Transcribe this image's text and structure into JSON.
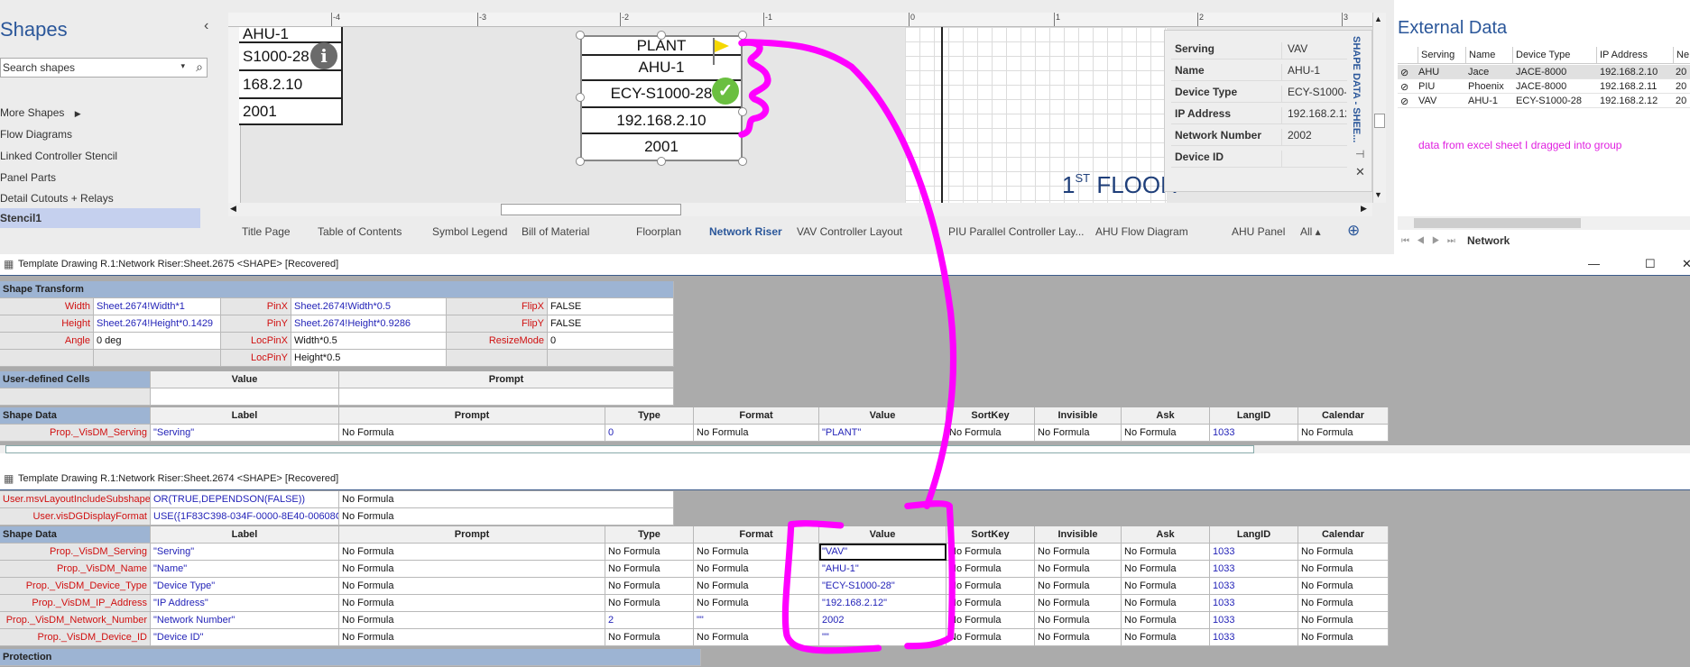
{
  "shapes_pane": {
    "title": "Shapes",
    "search_placeholder": "Search shapes",
    "items": [
      "More Shapes",
      "Flow Diagrams",
      "Linked Controller Stencil",
      "Panel Parts",
      "Detail Cutouts + Relays",
      "Stencil1"
    ],
    "selected": "Stencil1"
  },
  "ruler": {
    "labels": [
      "-4",
      "-3",
      "-2",
      "-1",
      "0",
      "1",
      "2",
      "3"
    ]
  },
  "canvas": {
    "partial_shape_rows": [
      "AHU-1",
      "S1000-28",
      "168.2.10",
      "2001"
    ],
    "main_shape_rows": [
      "PLANT",
      "AHU-1",
      "ECY-S1000-28",
      "192.168.2.10",
      "2001"
    ],
    "page_text_main": "1",
    "page_text_sup": "ST",
    "page_text_rest": " FLOOR"
  },
  "shape_data_panel": {
    "title": "SHAPE DATA - SHEE...",
    "rows": [
      {
        "key": "Serving",
        "value": "VAV"
      },
      {
        "key": "Name",
        "value": "AHU-1"
      },
      {
        "key": "Device Type",
        "value": "ECY-S1000-28"
      },
      {
        "key": "IP Address",
        "value": "192.168.2.12"
      },
      {
        "key": "Network Number",
        "value": "2002"
      },
      {
        "key": "Device ID",
        "value": ""
      }
    ]
  },
  "page_tabs": [
    "Title Page",
    "Table of Contents",
    "Symbol Legend",
    "Bill of Material",
    "Floorplan",
    "Network Riser",
    "VAV Controller Layout",
    "PIU Parallel Controller Lay...",
    "AHU Flow Diagram",
    "AHU Panel",
    "All ▴"
  ],
  "active_tab": "Network Riser",
  "external_data": {
    "title": "External Data",
    "columns": [
      "Serving",
      "Name",
      "Device Type",
      "IP Address",
      "Ne"
    ],
    "rows": [
      [
        "AHU",
        "Jace",
        "JACE-8000",
        "192.168.2.10",
        "20"
      ],
      [
        "PIU",
        "Phoenix",
        "JACE-8000",
        "192.168.2.11",
        "20"
      ],
      [
        "VAV",
        "AHU-1",
        "ECY-S1000-28",
        "192.168.2.12",
        "20"
      ]
    ],
    "note": "data from excel sheet I dragged into group",
    "sheet_tab": "Network"
  },
  "window1": {
    "title": "Template Drawing R.1:Network Riser:Sheet.2675 <SHAPE>  [Recovered]",
    "transform": {
      "section": "Shape Transform",
      "rows": [
        [
          "Width",
          "Sheet.2674!Width*1",
          "PinX",
          "Sheet.2674!Width*0.5",
          "FlipX",
          "FALSE"
        ],
        [
          "Height",
          "Sheet.2674!Height*0.1429",
          "PinY",
          "Sheet.2674!Height*0.9286",
          "FlipY",
          "FALSE"
        ],
        [
          "Angle",
          "0 deg",
          "LocPinX",
          "Width*0.5",
          "ResizeMode",
          "0"
        ],
        [
          "",
          "",
          "LocPinY",
          "Height*0.5",
          "",
          ""
        ]
      ]
    },
    "user_cells": {
      "section": "User-defined Cells",
      "headers": [
        "Value",
        "Prompt"
      ]
    },
    "shape_data": {
      "section": "Shape Data",
      "headers": [
        "Label",
        "Prompt",
        "Type",
        "Format",
        "Value",
        "SortKey",
        "Invisible",
        "Ask",
        "LangID",
        "Calendar"
      ],
      "rows": [
        [
          "Prop._VisDM_Serving",
          "\"Serving\"",
          "No Formula",
          "0",
          "No Formula",
          "\"PLANT\"",
          "No Formula",
          "No Formula",
          "No Formula",
          "1033",
          "No Formula"
        ]
      ]
    }
  },
  "window2": {
    "title": "Template Drawing R.1:Network Riser:Sheet.2674 <SHAPE>  [Recovered]",
    "user_rows": [
      [
        "User.msvLayoutIncludeSubshapes",
        "OR(TRUE,DEPENDSON(FALSE))",
        "No Formula"
      ],
      [
        "User.visDGDisplayFormat",
        "USE({1F83C398-034F-0000-8E40-00608C",
        "No Formula"
      ]
    ],
    "shape_data": {
      "section": "Shape Data",
      "headers": [
        "Label",
        "Prompt",
        "Type",
        "Format",
        "Value",
        "SortKey",
        "Invisible",
        "Ask",
        "LangID",
        "Calendar"
      ],
      "rows": [
        [
          "Prop._VisDM_Serving",
          "\"Serving\"",
          "No Formula",
          "No Formula",
          "No Formula",
          "\"VAV\"",
          "No Formula",
          "No Formula",
          "No Formula",
          "1033",
          "No Formula"
        ],
        [
          "Prop._VisDM_Name",
          "\"Name\"",
          "No Formula",
          "No Formula",
          "No Formula",
          "\"AHU-1\"",
          "No Formula",
          "No Formula",
          "No Formula",
          "1033",
          "No Formula"
        ],
        [
          "Prop._VisDM_Device_Type",
          "\"Device Type\"",
          "No Formula",
          "No Formula",
          "No Formula",
          "\"ECY-S1000-28\"",
          "No Formula",
          "No Formula",
          "No Formula",
          "1033",
          "No Formula"
        ],
        [
          "Prop._VisDM_IP_Address",
          "\"IP Address\"",
          "No Formula",
          "No Formula",
          "No Formula",
          "\"192.168.2.12\"",
          "No Formula",
          "No Formula",
          "No Formula",
          "1033",
          "No Formula"
        ],
        [
          "Prop._VisDM_Network_Number",
          "\"Network Number\"",
          "No Formula",
          "2",
          "\"\"",
          "2002",
          "No Formula",
          "No Formula",
          "No Formula",
          "1033",
          "No Formula"
        ],
        [
          "Prop._VisDM_Device_ID",
          "\"Device ID\"",
          "No Formula",
          "No Formula",
          "No Formula",
          "\"\"",
          "No Formula",
          "No Formula",
          "No Formula",
          "1033",
          "No Formula"
        ]
      ]
    },
    "protection_section": "Protection"
  },
  "annotation_color": "#ff00ff"
}
